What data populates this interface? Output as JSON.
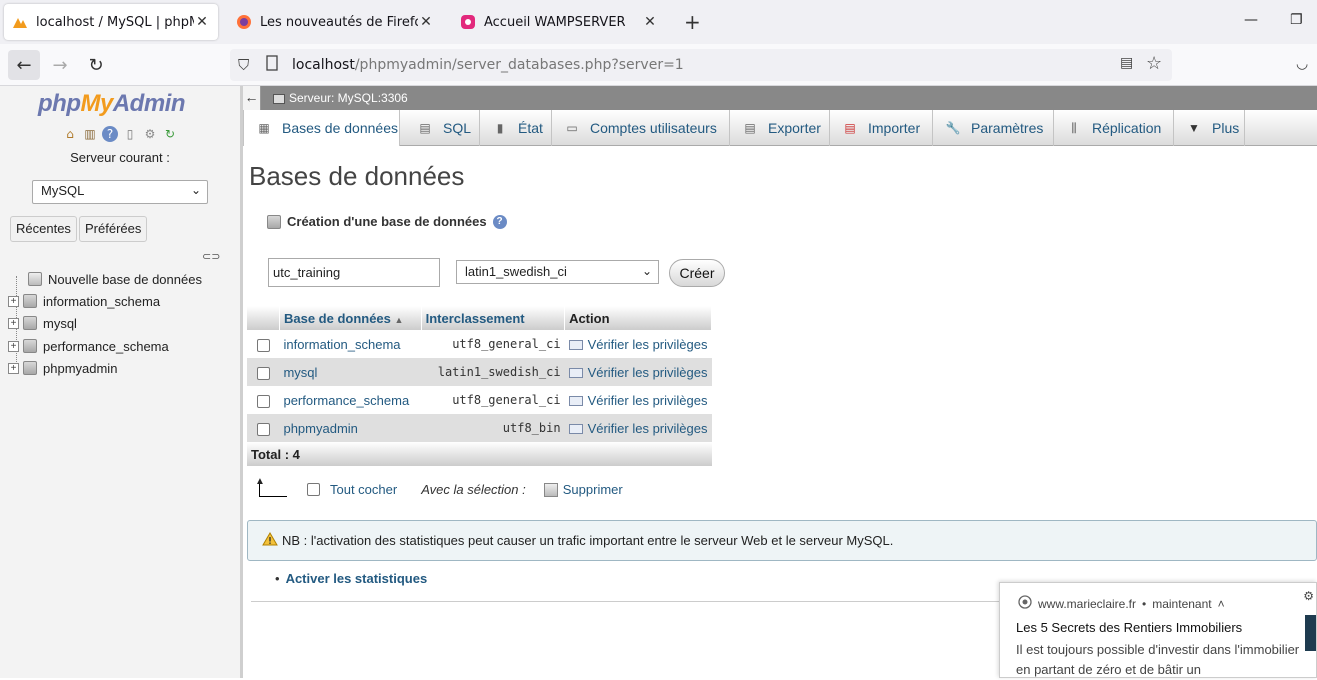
{
  "browser": {
    "tabs": [
      {
        "title": "localhost / MySQL | phpMyAdmin",
        "active": true
      },
      {
        "title": "Les nouveautés de Firefox : enco",
        "active": false
      },
      {
        "title": "Accueil WAMPSERVER",
        "active": false
      }
    ],
    "url_host": "localhost",
    "url_path": "/phpmyadmin/server_databases.php?server=1"
  },
  "left": {
    "logo": {
      "php": "php",
      "my": "My",
      "admin": "Admin"
    },
    "server_label": "Serveur courant :",
    "server_value": "MySQL",
    "recent_label": "Récentes",
    "favorites_label": "Préférées",
    "tree": [
      {
        "label": "Nouvelle base de données"
      },
      {
        "label": "information_schema"
      },
      {
        "label": "mysql"
      },
      {
        "label": "performance_schema"
      },
      {
        "label": "phpmyadmin"
      }
    ]
  },
  "main": {
    "breadcrumb": "Serveur: MySQL:3306",
    "tabs": [
      {
        "label": "Bases de données",
        "icon": "database-icon"
      },
      {
        "label": "SQL",
        "icon": "sql-icon"
      },
      {
        "label": "État",
        "icon": "status-icon"
      },
      {
        "label": "Comptes utilisateurs",
        "icon": "users-icon"
      },
      {
        "label": "Exporter",
        "icon": "export-icon"
      },
      {
        "label": "Importer",
        "icon": "import-icon"
      },
      {
        "label": "Paramètres",
        "icon": "wrench-icon"
      },
      {
        "label": "Réplication",
        "icon": "replication-icon"
      },
      {
        "label": "Plus",
        "icon": "chevron-down-icon"
      }
    ],
    "title": "Bases de données",
    "create_header": "Création d'une base de données",
    "db_name_value": "utc_training",
    "collation_value": "latin1_swedish_ci",
    "create_button": "Créer",
    "table": {
      "headers": [
        "Base de données",
        "Interclassement",
        "Action"
      ],
      "rows": [
        {
          "name": "information_schema",
          "collation": "utf8_general_ci",
          "action": "Vérifier les privilèges"
        },
        {
          "name": "mysql",
          "collation": "latin1_swedish_ci",
          "action": "Vérifier les privilèges"
        },
        {
          "name": "performance_schema",
          "collation": "utf8_general_ci",
          "action": "Vérifier les privilèges"
        },
        {
          "name": "phpmyadmin",
          "collation": "utf8_bin",
          "action": "Vérifier les privilèges"
        }
      ],
      "total": "Total : 4"
    },
    "check_all": "Tout cocher",
    "with_selection": "Avec la sélection :",
    "delete": "Supprimer",
    "notice": "NB : l'activation des statistiques peut causer un trafic important entre le serveur Web et le serveur MySQL.",
    "enable_stats": "Activer les statistiques"
  },
  "notification": {
    "source": "www.marieclaire.fr",
    "time": "maintenant",
    "title": "Les 5 Secrets des Rentiers Immobiliers",
    "body": "Il est toujours possible d'investir dans l'immobilier en partant de zéro et de bâtir un"
  },
  "colors": {
    "link": "#235a81",
    "logo_blue": "#6c78af",
    "logo_orange": "#f29b1d"
  }
}
